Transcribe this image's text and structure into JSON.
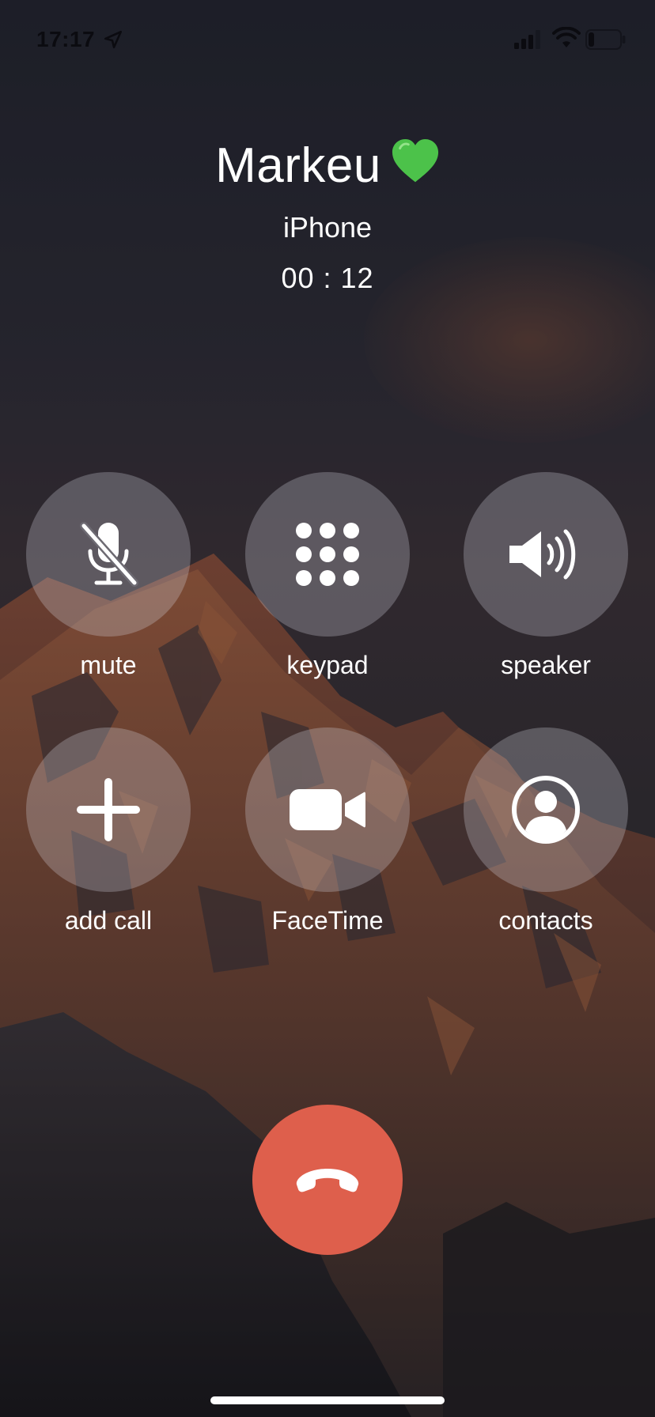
{
  "status_bar": {
    "time": "17:17",
    "location_icon": "location-arrow-icon",
    "signal_icon": "cellular-signal-icon",
    "wifi_icon": "wifi-icon",
    "battery_icon": "battery-low-icon",
    "battery_level": 0.15
  },
  "caller": {
    "name": "Markeu",
    "emoji_icon": "green-heart-icon",
    "line": "iPhone",
    "duration": "00 : 12"
  },
  "controls": [
    {
      "label": "mute",
      "icon": "microphone-muted-icon"
    },
    {
      "label": "keypad",
      "icon": "keypad-icon"
    },
    {
      "label": "speaker",
      "icon": "speaker-icon"
    },
    {
      "label": "add call",
      "icon": "plus-icon"
    },
    {
      "label": "FaceTime",
      "icon": "video-camera-icon"
    },
    {
      "label": "contacts",
      "icon": "contact-person-icon"
    }
  ],
  "end_call": {
    "icon": "phone-hangup-icon"
  },
  "colors": {
    "end_call": "#de5f4c",
    "button_bg": "rgba(215,215,225,0.28)",
    "heart": "#4cc24a",
    "text": "#ffffff"
  }
}
